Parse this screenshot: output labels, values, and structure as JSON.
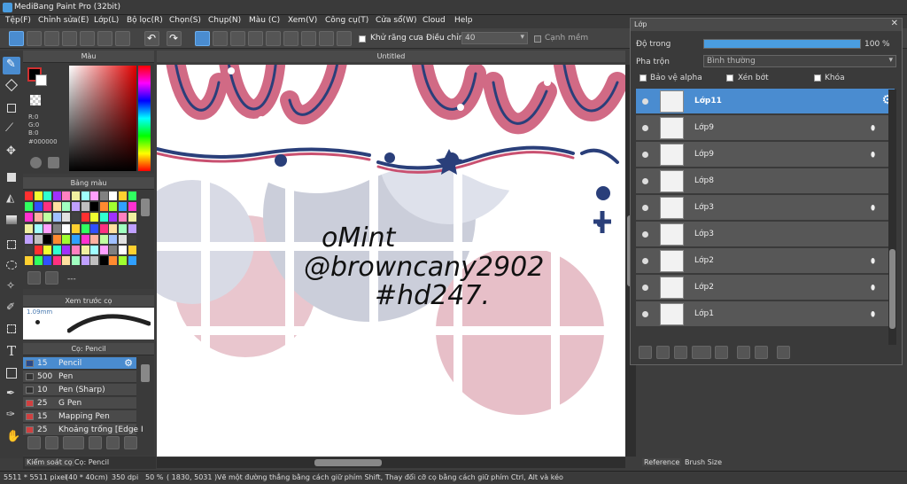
{
  "window": {
    "title": "MediBang Paint Pro (32bit)"
  },
  "menu": [
    "Tệp(F)",
    "Chỉnh sửa(E)",
    "Lớp(L)",
    "Bộ lọc(R)",
    "Chọn(S)",
    "Chụp(N)",
    "Màu (C)",
    "Xem(V)",
    "Công cụ(T)",
    "Cửa sổ(W)",
    "Cloud",
    "Help"
  ],
  "toolbar": {
    "antialias_label": "Khử răng cưa",
    "adjust_label": "Điều chỉnh",
    "adjust_value": "40",
    "edge_label": "Cạnh mềm"
  },
  "color_panel": {
    "title": "Màu",
    "r": "R:0",
    "g": "G:0",
    "b": "B:0",
    "hex": "#000000"
  },
  "palette_panel": {
    "title": "Bảng màu",
    "note": "---"
  },
  "brush_preview": {
    "title": "Xem trước cọ",
    "size": "1.09mm"
  },
  "brush_panel": {
    "title": "Cọ: Pencil",
    "items": [
      {
        "size": "15",
        "name": "Pencil",
        "color": "#2a4a8a"
      },
      {
        "size": "500",
        "name": "Pen",
        "color": "#333333"
      },
      {
        "size": "10",
        "name": "Pen (Sharp)",
        "color": "#333333"
      },
      {
        "size": "25",
        "name": "G Pen",
        "color": "#d04040"
      },
      {
        "size": "15",
        "name": "Mapping Pen",
        "color": "#d04040"
      },
      {
        "size": "25",
        "name": "Khoảng trống [Edge I",
        "color": "#d04040"
      }
    ]
  },
  "left_tabs": [
    "Kiểm soát cọ",
    "Cọ: Pencil"
  ],
  "document": {
    "tab": "Untitled",
    "signature_lines": [
      "oMint",
      "@browncany2902",
      "#hd247."
    ]
  },
  "layer_window": {
    "title": "Lớp",
    "opacity_label": "Độ trong",
    "opacity_value": "100 %",
    "blend_label": "Pha trộn",
    "blend_value": "Bình thường",
    "protect_alpha": "Bảo vệ alpha",
    "clipping": "Xén bớt",
    "lock": "Khóa",
    "layers": [
      {
        "name": "Lớp11",
        "selected": true
      },
      {
        "name": "Lớp9"
      },
      {
        "name": "Lớp9"
      },
      {
        "name": "Lớp8"
      },
      {
        "name": "Lớp3"
      },
      {
        "name": "Lớp3"
      },
      {
        "name": "Lớp2"
      },
      {
        "name": "Lớp2"
      },
      {
        "name": "Lớp1"
      }
    ]
  },
  "right_tabs": [
    "Reference",
    "Brush Size"
  ],
  "status": {
    "size": "5511 * 5511 pixel",
    "cm": "(40 * 40cm)",
    "dpi": "350 dpi",
    "zoom": "50 %",
    "coords": "( 1830, 5031 )",
    "hint": "Vẽ một đường thẳng bằng cách giữ phím Shift, Thay đổi cỡ cọ bằng cách giữ phím Ctrl, Alt và kéo"
  },
  "colors": {
    "accent": "#4a8cd0",
    "stroke_blue": "#2a3f7a",
    "stroke_pink": "#c95070",
    "shape_blue": "#b8bdd0",
    "shape_pink": "#e2a8b4"
  }
}
